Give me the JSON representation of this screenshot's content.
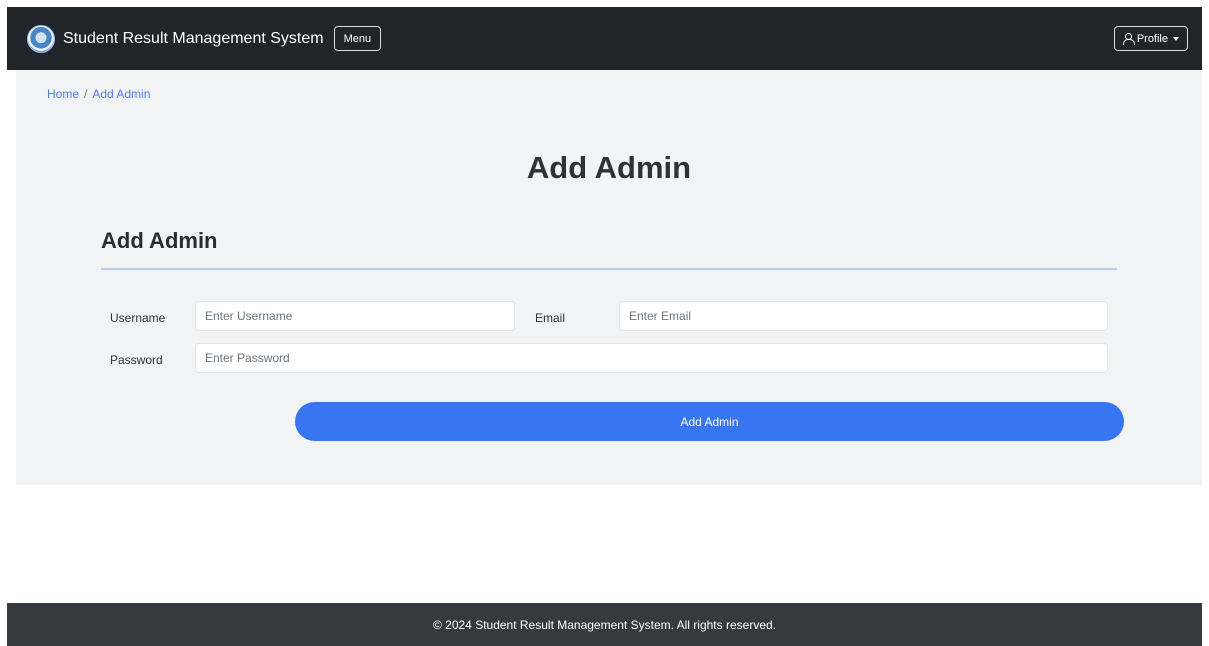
{
  "navbar": {
    "brand": "Student Result Management System",
    "menu_label": "Menu",
    "profile_label": "Profile"
  },
  "breadcrumb": {
    "home": "Home",
    "separator": "/",
    "current": "Add Admin"
  },
  "page_title": "Add Admin",
  "form": {
    "section_title": "Add Admin",
    "username_label": "Username",
    "username_placeholder": "Enter Username",
    "username_value": "",
    "email_label": "Email",
    "email_placeholder": "Enter Email",
    "email_value": "",
    "password_label": "Password",
    "password_placeholder": "Enter Password",
    "password_value": "",
    "submit_label": "Add Admin"
  },
  "footer": {
    "text": "© 2024 Student Result Management System. All rights reserved."
  },
  "colors": {
    "navbar_bg": "#212529",
    "accent": "#3776f0",
    "content_bg": "#f2f3f5",
    "footer_bg": "#343a40"
  }
}
